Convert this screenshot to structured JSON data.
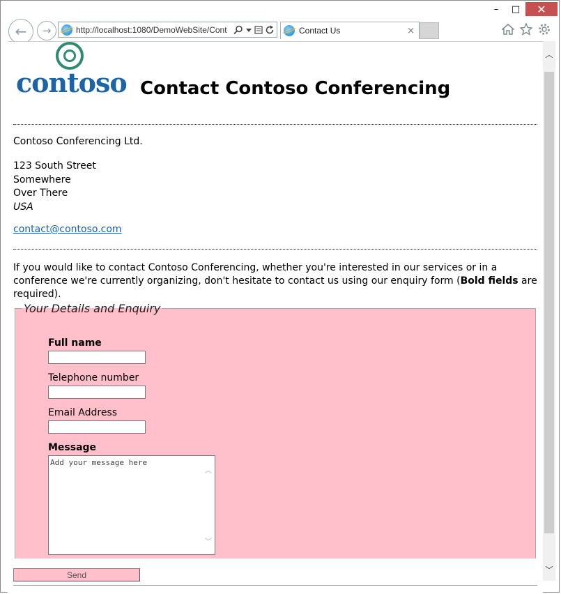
{
  "browser": {
    "address_url": "http://localhost:1080/DemoWebSite/Cont",
    "tab_title": "Contact Us",
    "tab_close_glyph": "×",
    "minimize_glyph": "–",
    "maximize_glyph": "□",
    "close_glyph": "✕",
    "back_glyph": "←",
    "forward_glyph": "→",
    "icons": [
      "ie-page-icon",
      "search-icon",
      "dropdown-icon",
      "compat-view-icon",
      "refresh-icon",
      "home-icon",
      "favorites-star-icon",
      "settings-gear-icon"
    ]
  },
  "page": {
    "logo_text": "contoso",
    "heading": "Contact Contoso Conferencing",
    "org_name": "Contoso Conferencing Ltd.",
    "address": {
      "line1": "123 South Street",
      "line2": "Somewhere",
      "line3": "Over There",
      "country": "USA"
    },
    "email": "contact@contoso.com",
    "intro_before": "If you would like to contact Contoso Conferencing, whether you're interested in our services or in a conference we're currently organizing, don't hesitate to contact us using our enquiry form (",
    "intro_bold": "Bold fields",
    "intro_after": " are required)."
  },
  "form": {
    "legend": "Your Details and Enquiry",
    "full_name_label": "Full name",
    "full_name_value": "",
    "telephone_label": "Telephone number",
    "telephone_value": "",
    "email_label": "Email Address",
    "email_value": "",
    "message_label": "Message",
    "message_placeholder": "Add your message here",
    "send_label": "Send"
  },
  "colors": {
    "form_background": "#ffc0cb",
    "link": "#1a5cb8",
    "logo_blue": "#1b64a8",
    "logo_green": "#2e8b72",
    "window_close": "#c75050"
  }
}
